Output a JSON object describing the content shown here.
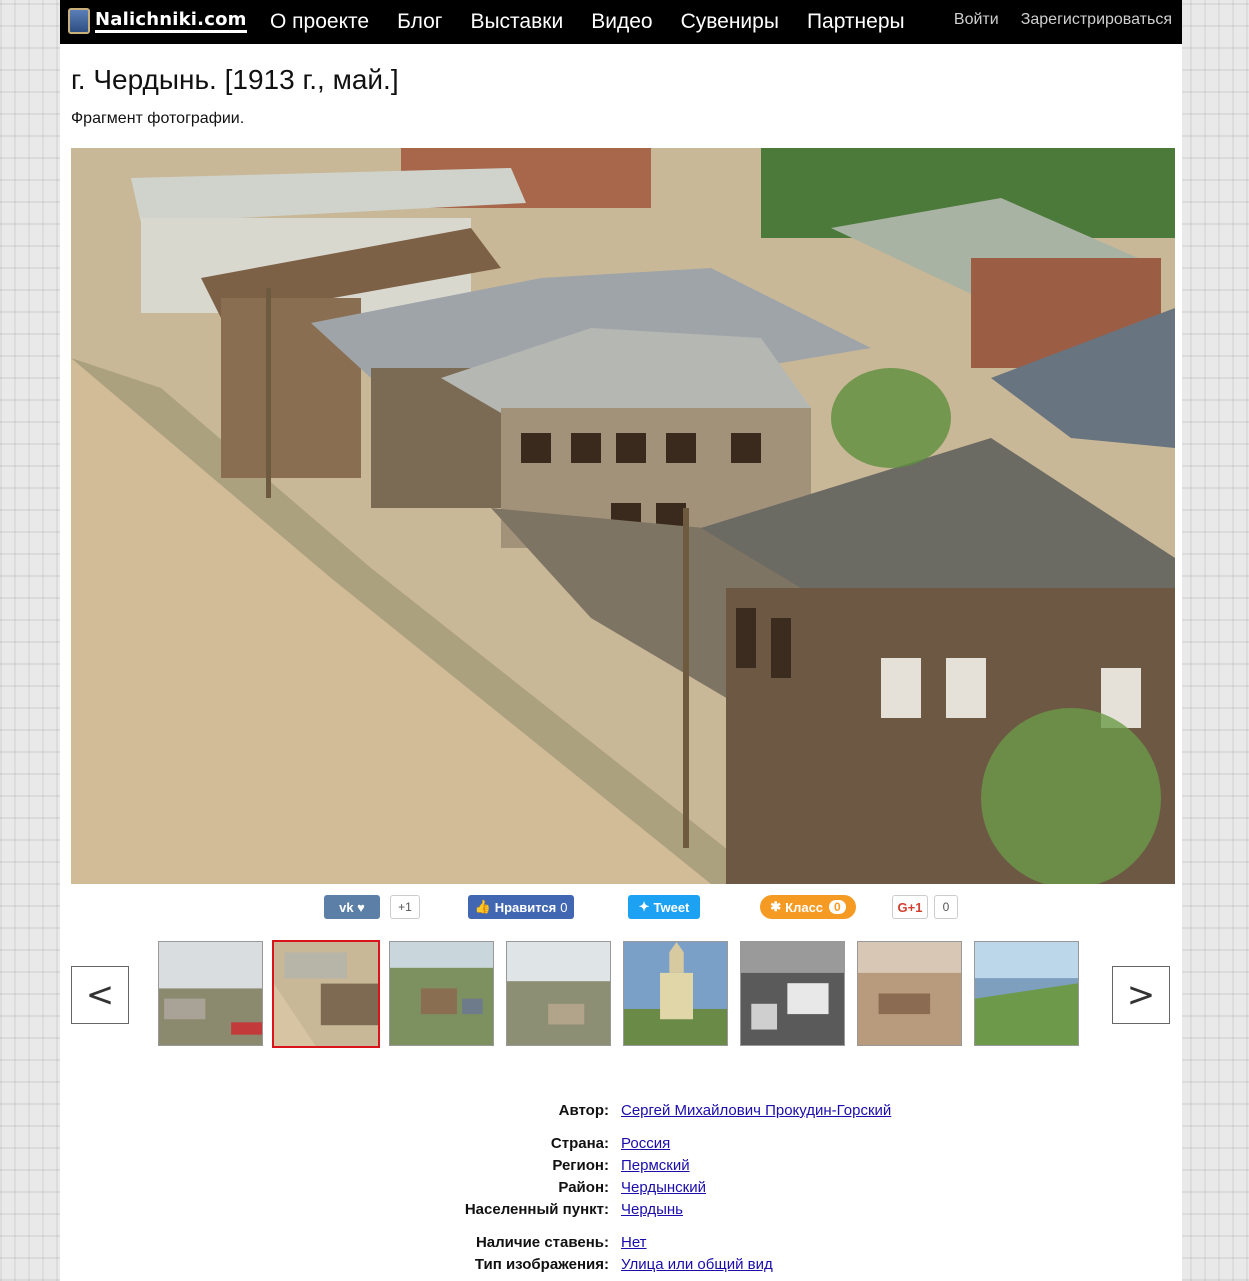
{
  "header": {
    "logo_text": "Nalichniki.com",
    "nav": [
      "О проекте",
      "Блог",
      "Выставки",
      "Видео",
      "Сувениры",
      "Партнеры"
    ],
    "login": "Войти",
    "register": "Зарегистрироваться"
  },
  "page": {
    "title": "г. Чердынь. [1913 г., май.]",
    "subtitle": "Фрагмент фотографии."
  },
  "social": {
    "vk_count": "+1",
    "fb_label": "Нравится",
    "fb_count": "0",
    "twitter_label": "Tweet",
    "ok_label": "Класс",
    "ok_count": "0",
    "gplus_label": "G+1",
    "gplus_count": "0"
  },
  "carousel": {
    "prev": "<",
    "next": ">",
    "active_index": 1,
    "thumbnail_count": 8
  },
  "details": {
    "author_label": "Автор:",
    "author_value": "Сергей Михайлович Прокудин-Горский",
    "country_label": "Страна:",
    "country_value": "Россия",
    "region_label": "Регион:",
    "region_value": "Пермский",
    "district_label": "Район:",
    "district_value": "Чердынский",
    "settlement_label": "Населенный пункт:",
    "settlement_value": "Чердынь",
    "shutters_label": "Наличие ставень:",
    "shutters_value": "Нет",
    "image_type_label": "Тип изображения:",
    "image_type_value": "Улица или общий вид"
  },
  "colors": {
    "topbar": "#000000",
    "link": "#1a0dab",
    "active_thumb_border": "#d9141b",
    "vk": "#5b7fa6",
    "facebook": "#4267b2",
    "twitter": "#1da1f2",
    "odnoklassniki": "#f59a22"
  }
}
